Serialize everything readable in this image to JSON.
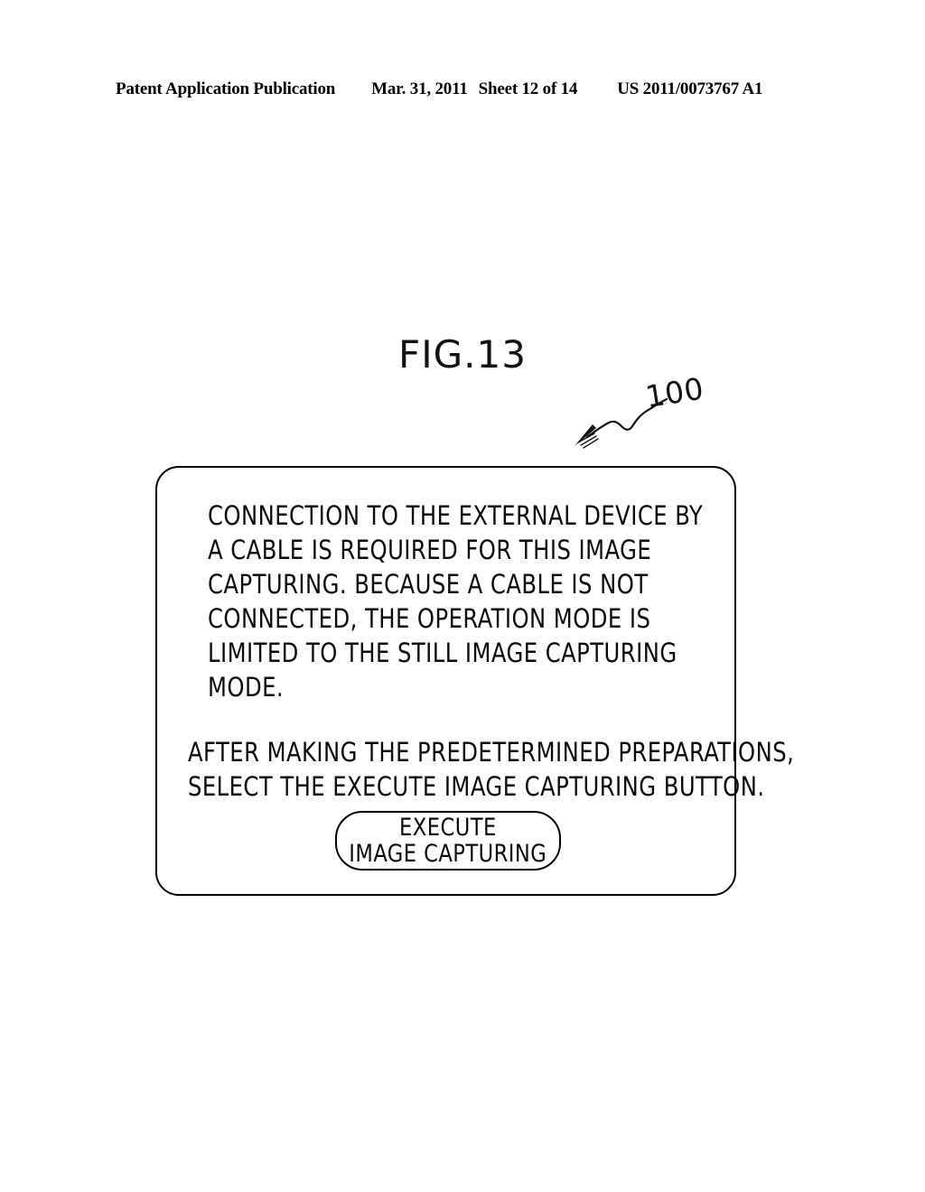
{
  "sheet_header": {
    "publication": "Patent Application Publication",
    "date": "Mar. 31, 2011",
    "sheet": "Sheet 12 of 14",
    "patent_number": "US 2011/0073767 A1"
  },
  "figure": {
    "title": "FIG.13",
    "reference_numeral": "100"
  },
  "dialog": {
    "message_paragraph_1": [
      "CONNECTION TO THE EXTERNAL DEVICE BY",
      "A CABLE IS REQUIRED FOR THIS IMAGE",
      "CAPTURING.  BECAUSE A CABLE IS NOT",
      "CONNECTED, THE OPERATION MODE IS",
      "LIMITED TO THE STILL IMAGE CAPTURING",
      "MODE."
    ],
    "message_paragraph_2": [
      "AFTER MAKING THE PREDETERMINED PREPARATIONS,",
      "SELECT THE EXECUTE IMAGE CAPTURING BUTTON."
    ],
    "execute_button": {
      "line_1": "EXECUTE",
      "line_2": "IMAGE CAPTURING"
    }
  },
  "colors": {
    "ink": "#000000",
    "background": "#ffffff"
  }
}
